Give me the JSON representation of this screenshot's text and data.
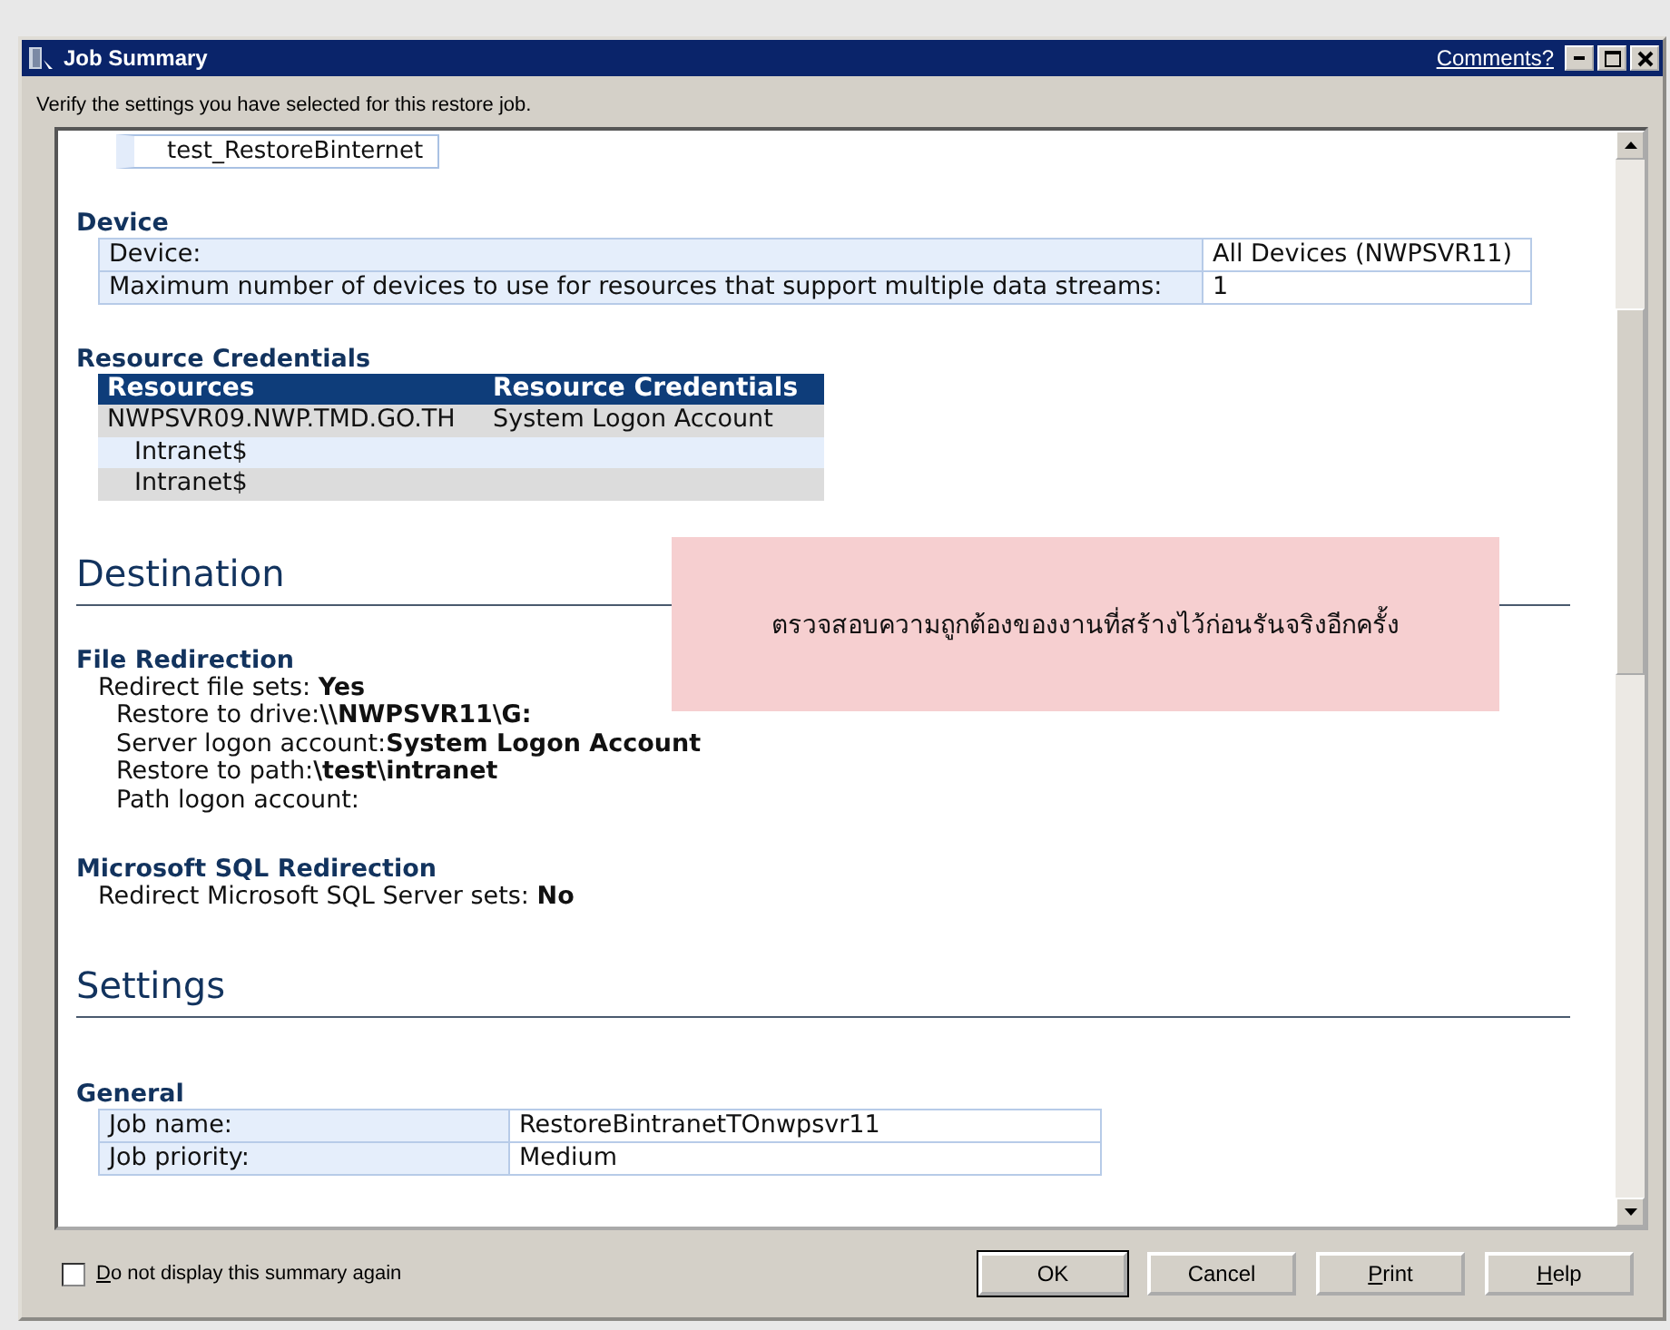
{
  "window": {
    "title": "Job Summary",
    "comments_link": "Comments?"
  },
  "instruction": "Verify the settings you have selected for this restore job.",
  "top_item": "test_RestoreBinternet",
  "device": {
    "heading": "Device",
    "rows": [
      {
        "label": "Device:",
        "value": "All Devices (NWPSVR11)"
      },
      {
        "label": "Maximum number of devices to use for resources that support multiple data streams:",
        "value": "1"
      }
    ]
  },
  "resource_credentials": {
    "heading": "Resource Credentials",
    "columns": [
      "Resources",
      "Resource Credentials"
    ],
    "rows": [
      {
        "resource": "NWPSVR09.NWP.TMD.GO.TH",
        "credential": "System Logon Account",
        "children": [
          {
            "resource": "Intranet$"
          },
          {
            "resource": "Intranet$"
          }
        ]
      }
    ]
  },
  "destination": {
    "heading": "Destination",
    "groups": [
      {
        "heading": "File Redirection",
        "lines": [
          {
            "label": "Redirect file sets: ",
            "value": "Yes",
            "children": [
              {
                "label": "Restore to drive:",
                "value": "\\\\NWPSVR11\\G:"
              },
              {
                "label": "Server logon account:",
                "value": "System Logon Account"
              },
              {
                "label": "Restore to path:",
                "value": "\\test\\intranet"
              },
              {
                "label": "Path logon account:"
              }
            ]
          }
        ]
      },
      {
        "heading": "Microsoft SQL Redirection",
        "lines": [
          {
            "label": "Redirect Microsoft SQL Server sets: ",
            "value": "No"
          }
        ]
      }
    ]
  },
  "settings": {
    "heading": "Settings",
    "groups": [
      {
        "heading": "General",
        "rows": [
          {
            "label": "Job name:",
            "value": "RestoreBintranetTOnwpsvr11"
          },
          {
            "label": "Job priority:",
            "value": "Medium"
          }
        ]
      }
    ]
  },
  "note": "ตรวจสอบความถูกต้องของงานที่สร้างไว้ก่อนรันจริงอีกครั้ง",
  "footer": {
    "checkbox": {
      "label": "Do not display this summary again",
      "checked": false,
      "underline_first": true
    },
    "buttons": [
      {
        "label": "OK",
        "default": true,
        "underline_first": false
      },
      {
        "label": "Cancel",
        "default": false,
        "underline_first": false
      },
      {
        "label": "Print",
        "default": false,
        "underline_first": true
      },
      {
        "label": "Help",
        "default": false,
        "underline_first": true
      }
    ]
  }
}
